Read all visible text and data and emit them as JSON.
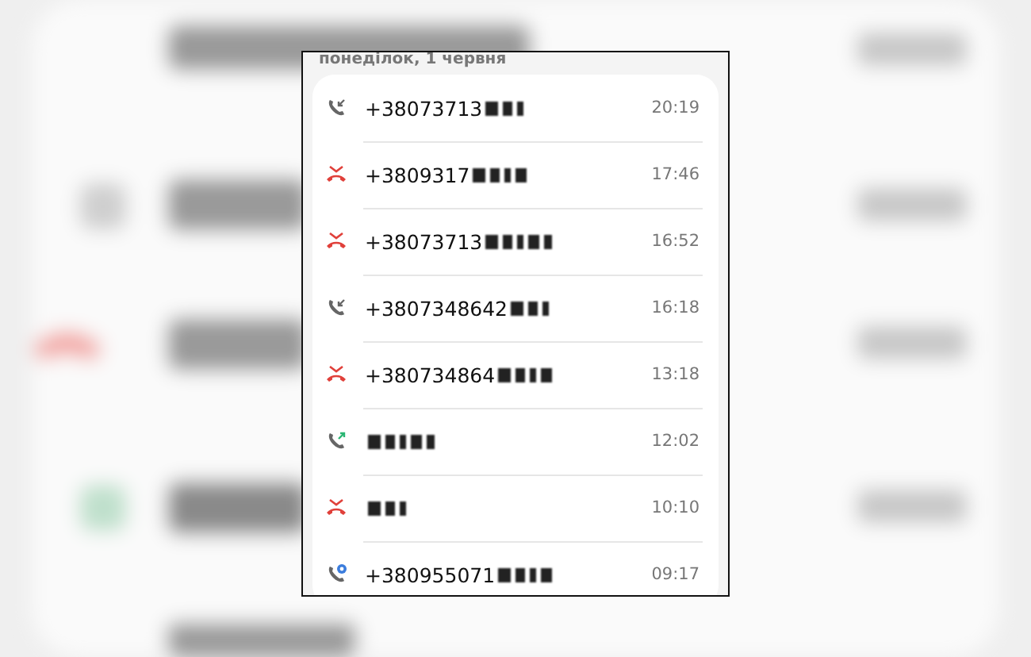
{
  "date_header": "понеділок, 1 червня",
  "calls": [
    {
      "kind": "incoming",
      "number": "+38073713",
      "redacted": true,
      "time": "20:19"
    },
    {
      "kind": "missed",
      "number": "+3809317",
      "redacted": true,
      "time": "17:46"
    },
    {
      "kind": "missed",
      "number": "+38073713",
      "redacted": true,
      "time": "16:52"
    },
    {
      "kind": "incoming",
      "number": "+3807348642",
      "redacted": true,
      "time": "16:18"
    },
    {
      "kind": "missed",
      "number": "+380734864",
      "redacted": true,
      "time": "13:18"
    },
    {
      "kind": "outgoing",
      "redacted": true,
      "time": "12:02"
    },
    {
      "kind": "missed",
      "redacted": true,
      "time": "10:10"
    },
    {
      "kind": "wifi",
      "number": "+380955071",
      "redacted": true,
      "time": "09:17"
    }
  ]
}
